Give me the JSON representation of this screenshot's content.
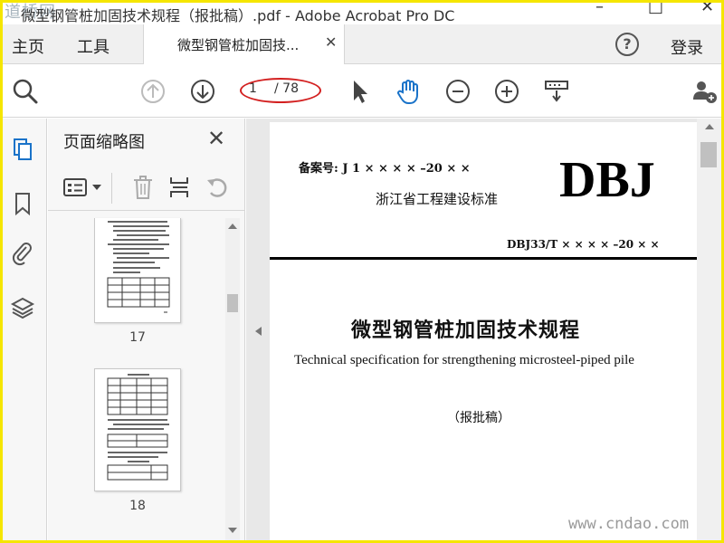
{
  "window": {
    "title": "微型钢管桩加固技术规程（报批稿）.pdf - Adobe Acrobat Pro DC",
    "logo_text": "道桥网",
    "controls": {
      "minimize": "–",
      "maximize": "□",
      "close": "✕"
    }
  },
  "menubar": {
    "home": "主页",
    "tools": "工具",
    "tab_label": "微型钢管桩加固技...",
    "tab_close": "✕",
    "help": "?",
    "login": "登录"
  },
  "toolbar": {
    "current_page": "1",
    "total_pages": "/ 78",
    "accent_color": "#1a73c9",
    "annotation_color": "#d32020"
  },
  "thumbnail_panel": {
    "title": "页面缩略图",
    "close": "✕",
    "pages": [
      {
        "label": "17"
      },
      {
        "label": "18"
      }
    ]
  },
  "document": {
    "registration": "备案号: J 1 × × × × –20 × ×",
    "organization": "浙江省工程建设标准",
    "standard": "DBJ",
    "code": "DBJ33/T  × × × × –20 × ×",
    "title_cn": "微型钢管桩加固技术规程",
    "title_en": "Technical specification for strengthening microsteel-piped pile",
    "draft": "（报批稿）",
    "watermark": "www.cndao.com"
  }
}
